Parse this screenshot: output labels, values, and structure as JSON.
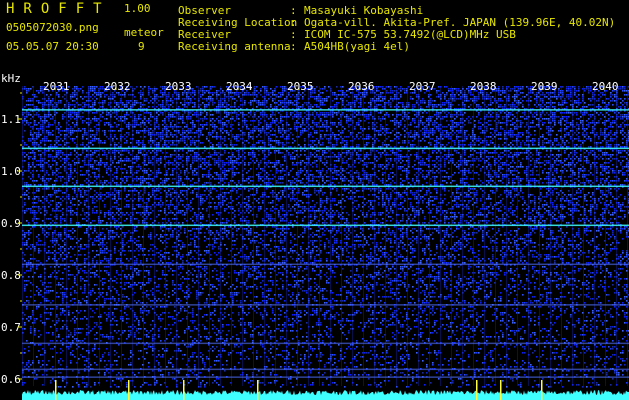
{
  "app": {
    "logo": "HROFFT",
    "version": "1.00"
  },
  "file": {
    "name": "0505072030.png",
    "datetime": "05.05.07 20:30"
  },
  "detection": {
    "label": "meteor",
    "count": "9"
  },
  "info": [
    {
      "key": "Observer",
      "sep": ":",
      "value": "Masayuki Kobayashi"
    },
    {
      "key": "Receiving Location",
      "sep": ":",
      "value": "Ogata-vill. Akita-Pref. JAPAN (139.96E, 40.02N)"
    },
    {
      "key": "Receiver",
      "sep": ":",
      "value": "ICOM IC-575 53.7492(@LCD)MHz USB"
    },
    {
      "key": "Receiving antenna",
      "sep": ":",
      "value": "A504HB(yagi 4el)"
    }
  ],
  "spectrogram": {
    "y_unit": "kHz",
    "y_ticks": [
      "1.1",
      "1.0",
      "0.9",
      "0.8",
      "0.7",
      "0.6"
    ],
    "x_ticks": [
      "2031",
      "2032",
      "2033",
      "2034",
      "2035",
      "2036",
      "2037",
      "2038",
      "2039",
      "2040"
    ],
    "colors": {
      "text": "#e6e600",
      "background": "#000000",
      "noise": "#1830ff",
      "signal": "#40ffff"
    }
  }
}
